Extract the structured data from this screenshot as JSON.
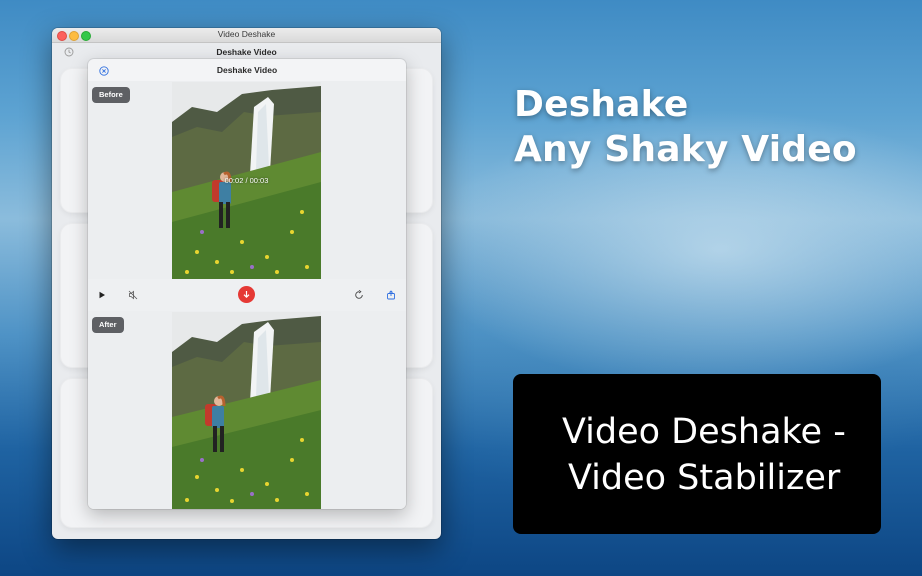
{
  "window": {
    "title": "Video Deshake"
  },
  "background_toolbar": {
    "title": "Deshake Video",
    "history_icon": "history-icon"
  },
  "sheet": {
    "title": "Deshake Video",
    "close_icon": "close-circle-icon",
    "before_label": "Before",
    "after_label": "After",
    "timestamp": "00:02 / 00:03"
  },
  "controls": {
    "play_icon": "play-icon",
    "mute_icon": "mute-icon",
    "download_icon": "download-icon",
    "reset_icon": "reset-icon",
    "export_icon": "export-icon",
    "download_color": "#e53935"
  },
  "marketing": {
    "headline_line1": "Deshake",
    "headline_line2": "Any Shaky Video",
    "banner_line1": "Video Deshake -",
    "banner_line2": "Video Stabilizer"
  }
}
